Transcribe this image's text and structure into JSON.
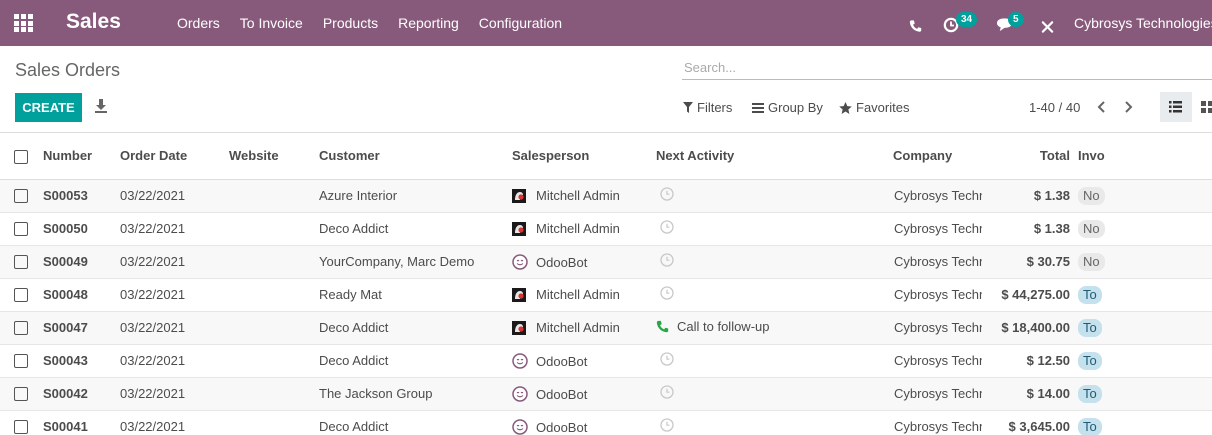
{
  "navbar": {
    "app_name": "Sales",
    "menu": [
      "Orders",
      "To Invoice",
      "Products",
      "Reporting",
      "Configuration"
    ],
    "activity_count": "34",
    "message_count": "5",
    "company": "Cybrosys Technologies",
    "bg_color": "#875a7b"
  },
  "control_panel": {
    "breadcrumb": "Sales Orders",
    "search_placeholder": "Search...",
    "create_label": "CREATE",
    "filters_label": "Filters",
    "group_by_label": "Group By",
    "favorites_label": "Favorites",
    "pager": "1-40 / 40",
    "accent_color": "#00a09d"
  },
  "table": {
    "headers": {
      "number": "Number",
      "order_date": "Order Date",
      "website": "Website",
      "customer": "Customer",
      "salesperson": "Salesperson",
      "next_activity": "Next Activity",
      "company": "Company",
      "total": "Total",
      "invoice_status": "Invo"
    },
    "rows": [
      {
        "number": "S00053",
        "date": "03/22/2021",
        "customer": "Azure Interior",
        "salesperson": "Mitchell Admin",
        "avatar": "admin",
        "activity": "",
        "company": "Cybrosys Technologies",
        "total": "$ 1.38",
        "status": "No",
        "status_kind": "no"
      },
      {
        "number": "S00050",
        "date": "03/22/2021",
        "customer": "Deco Addict",
        "salesperson": "Mitchell Admin",
        "avatar": "admin",
        "activity": "",
        "company": "Cybrosys Technologies",
        "total": "$ 1.38",
        "status": "No",
        "status_kind": "no"
      },
      {
        "number": "S00049",
        "date": "03/22/2021",
        "customer": "YourCompany, Marc Demo",
        "salesperson": "OdooBot",
        "avatar": "bot",
        "activity": "",
        "company": "Cybrosys Technologies",
        "total": "$ 30.75",
        "status": "No",
        "status_kind": "no"
      },
      {
        "number": "S00048",
        "date": "03/22/2021",
        "customer": "Ready Mat",
        "salesperson": "Mitchell Admin",
        "avatar": "admin",
        "activity": "",
        "company": "Cybrosys Technologies",
        "total": "$ 44,275.00",
        "status": "To",
        "status_kind": "to"
      },
      {
        "number": "S00047",
        "date": "03/22/2021",
        "customer": "Deco Addict",
        "salesperson": "Mitchell Admin",
        "avatar": "admin",
        "activity": "Call to follow-up",
        "company": "Cybrosys Technologies",
        "total": "$ 18,400.00",
        "status": "To",
        "status_kind": "to"
      },
      {
        "number": "S00043",
        "date": "03/22/2021",
        "customer": "Deco Addict",
        "salesperson": "OdooBot",
        "avatar": "bot",
        "activity": "",
        "company": "Cybrosys Technologies",
        "total": "$ 12.50",
        "status": "To",
        "status_kind": "to"
      },
      {
        "number": "S00042",
        "date": "03/22/2021",
        "customer": "The Jackson Group",
        "salesperson": "OdooBot",
        "avatar": "bot",
        "activity": "",
        "company": "Cybrosys Technologies",
        "total": "$ 14.00",
        "status": "To",
        "status_kind": "to"
      },
      {
        "number": "S00041",
        "date": "03/22/2021",
        "customer": "Deco Addict",
        "salesperson": "OdooBot",
        "avatar": "bot",
        "activity": "",
        "company": "Cybrosys Technologies",
        "total": "$ 3,645.00",
        "status": "To",
        "status_kind": "to"
      }
    ]
  }
}
